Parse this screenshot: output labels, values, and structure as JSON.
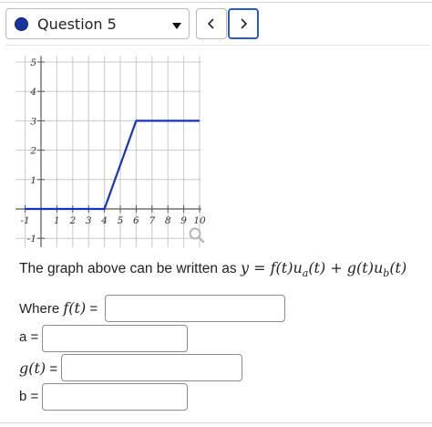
{
  "header": {
    "question_label": "Question 5",
    "prev_label": "<",
    "next_label": ">"
  },
  "colors": {
    "graph_line": "#1533c7",
    "question_dot": "#17359e",
    "next_border": "#2a59c9"
  },
  "chart_data": {
    "type": "line",
    "x_tick_labels": [
      "-1",
      "1",
      "2",
      "3",
      "4",
      "5",
      "6",
      "7",
      "8",
      "9",
      "10"
    ],
    "y_tick_labels": [
      "-1",
      "1",
      "2",
      "3",
      "4",
      "5"
    ],
    "xlim": [
      -1,
      10
    ],
    "ylim": [
      -1,
      5
    ],
    "grid": true,
    "series": [
      {
        "x": [
          -1,
          4,
          6,
          10
        ],
        "y": [
          0,
          0,
          3,
          3
        ]
      }
    ],
    "zoom_icon": "magnifier-icon"
  },
  "problem": {
    "statement_text": "The graph above can be written as ",
    "statement_math": "y = f(t)uₐ(t) + g(t)u_b(t)",
    "where_text": "Where ",
    "f_math": "f(t)",
    "eq": " =",
    "a_label": "a =",
    "g_math": "g(t)",
    "b_label": "b ="
  }
}
